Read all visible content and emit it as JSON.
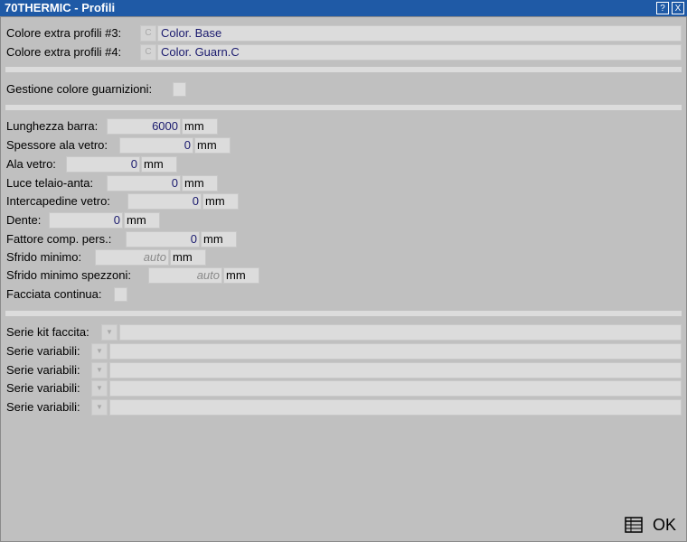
{
  "window": {
    "title": "70THERMIC - Profili",
    "help": "?",
    "close": "X"
  },
  "colors": {
    "row3": {
      "label": "Colore extra profili #3:",
      "btn": "C",
      "value": "Color. Base"
    },
    "row4": {
      "label": "Colore extra profili #4:",
      "btn": "C",
      "value": "Color. Guarn.C"
    },
    "accent": "#1f5aa6"
  },
  "gestione": {
    "label": "Gestione colore guarnizioni:"
  },
  "fields": {
    "lunghezza": {
      "label": "Lunghezza barra:",
      "value": "6000",
      "unit": "mm"
    },
    "spessore": {
      "label": "Spessore ala vetro:",
      "value": "0",
      "unit": "mm"
    },
    "ala": {
      "label": "Ala vetro:",
      "value": "0",
      "unit": "mm"
    },
    "luce": {
      "label": "Luce telaio-anta:",
      "value": "0",
      "unit": "mm"
    },
    "intercapedine": {
      "label": "Intercapedine vetro:",
      "value": "0",
      "unit": "mm"
    },
    "dente": {
      "label": "Dente:",
      "value": "0",
      "unit": "mm"
    },
    "fattore": {
      "label": "Fattore comp. pers.:",
      "value": "0",
      "unit": "mm"
    },
    "sfrido": {
      "label": "Sfrido minimo:",
      "value": "auto",
      "unit": "mm"
    },
    "sfrido_spezzoni": {
      "label": "Sfrido minimo spezzoni:",
      "value": "auto",
      "unit": "mm"
    }
  },
  "facciata": {
    "label": "Facciata continua:"
  },
  "serie": {
    "kit": {
      "label": "Serie kit faccita:"
    },
    "var1": {
      "label": "Serie variabili:"
    },
    "var2": {
      "label": "Serie variabili:"
    },
    "var3": {
      "label": "Serie variabili:"
    },
    "var4": {
      "label": "Serie variabili:"
    }
  },
  "footer": {
    "ok": "OK",
    "grid_icon": "table-icon"
  }
}
